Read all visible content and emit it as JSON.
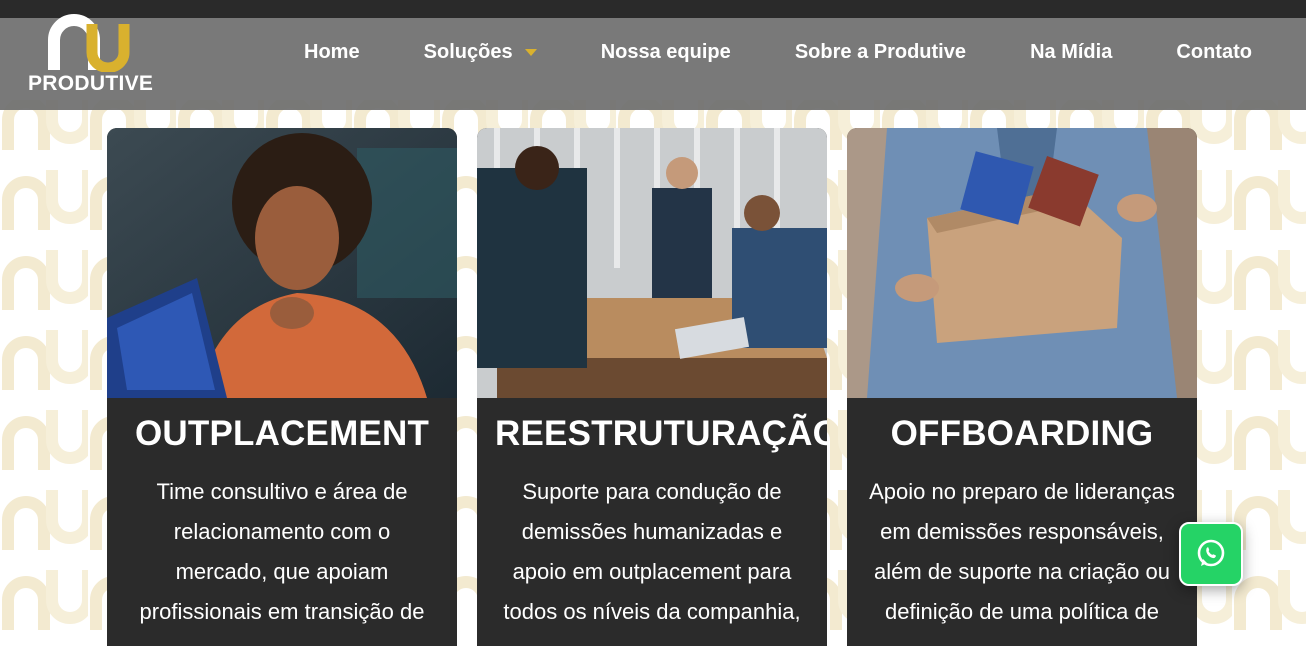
{
  "brand": {
    "name": "PRODUTIVE",
    "accent_color": "#d9b12e",
    "icon": "produtive-logo-mark"
  },
  "nav": {
    "items": [
      {
        "label": "Home"
      },
      {
        "label": "Soluções",
        "has_dropdown": true
      },
      {
        "label": "Nossa equipe"
      },
      {
        "label": "Sobre a Produtive"
      },
      {
        "label": "Na Mídia"
      },
      {
        "label": "Contato"
      }
    ]
  },
  "cards": [
    {
      "title": "OUTPLACEMENT",
      "text": "Time consultivo e área de relacionamento com o mercado, que apoiam profissionais em transição de",
      "image": "woman-with-tablet-photo"
    },
    {
      "title": "REESTRUTURAÇÃO",
      "text": "Suporte para condução de demissões humanizadas e apoio em outplacement para todos os níveis da companhia,",
      "image": "team-meeting-photo"
    },
    {
      "title": "OFFBOARDING",
      "text": "Apoio no preparo de lideranças em demissões responsáveis, além de suporte na criação ou definição de uma política de",
      "image": "person-carrying-box-photo"
    }
  ],
  "whatsapp": {
    "icon": "whatsapp-icon",
    "color": "#25d366"
  },
  "colors": {
    "header_bg": "#6e6e6e",
    "topbar_bg": "#2a2a2a",
    "card_bg": "#2b2b2b",
    "pattern": "#f3ead0"
  }
}
